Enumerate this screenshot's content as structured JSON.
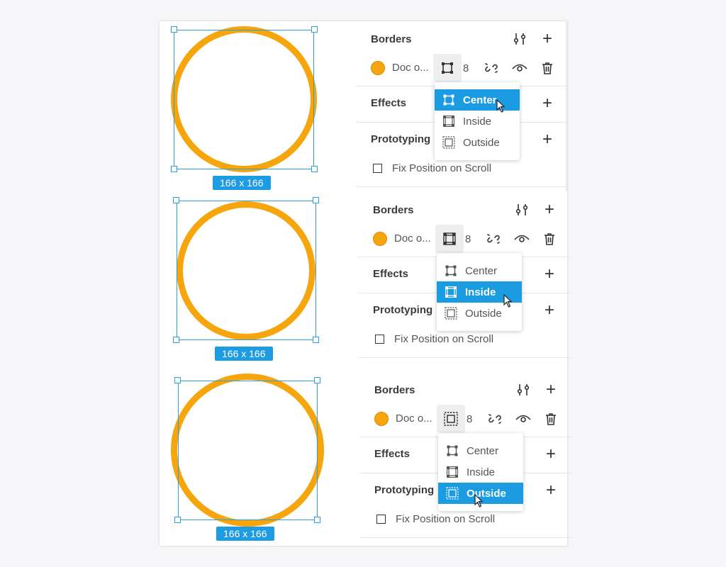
{
  "panels": [
    {
      "dimension_label": "166 x 166",
      "border_mode": "Center",
      "borders_title": "Borders",
      "fill_label": "Doc o...",
      "border_width": "8",
      "effects_title": "Effects",
      "prototyping_title": "Prototyping",
      "fix_position_label": "Fix Position on Scroll",
      "fix_position_checked": false,
      "dropdown": [
        "Center",
        "Inside",
        "Outside"
      ],
      "selected_option": "Center"
    },
    {
      "dimension_label": "166 x 166",
      "border_mode": "Inside",
      "borders_title": "Borders",
      "fill_label": "Doc o...",
      "border_width": "8",
      "effects_title": "Effects",
      "prototyping_title": "Prototyping",
      "fix_position_label": "Fix Position on Scroll",
      "fix_position_checked": false,
      "dropdown": [
        "Center",
        "Inside",
        "Outside"
      ],
      "selected_option": "Inside"
    },
    {
      "dimension_label": "166 x 166",
      "border_mode": "Outside",
      "borders_title": "Borders",
      "fill_label": "Doc o...",
      "border_width": "8",
      "effects_title": "Effects",
      "prototyping_title": "Prototyping",
      "fix_position_label": "Fix Position on Scroll",
      "fix_position_checked": false,
      "dropdown": [
        "Center",
        "Inside",
        "Outside"
      ],
      "selected_option": "Outside"
    }
  ],
  "icons": {
    "border_settings": "sliders-icon",
    "add": "plus-icon",
    "border_position": "border-position-icon",
    "detach": "unlink-icon",
    "visibility": "eye-icon",
    "delete": "trash-icon",
    "checkbox": "checkbox-icon",
    "pointer": "cursor-icon"
  },
  "colors": {
    "border_color": "#f7a50c",
    "selection": "#2d9ee0",
    "menu_highlight": "#1a9be2"
  }
}
